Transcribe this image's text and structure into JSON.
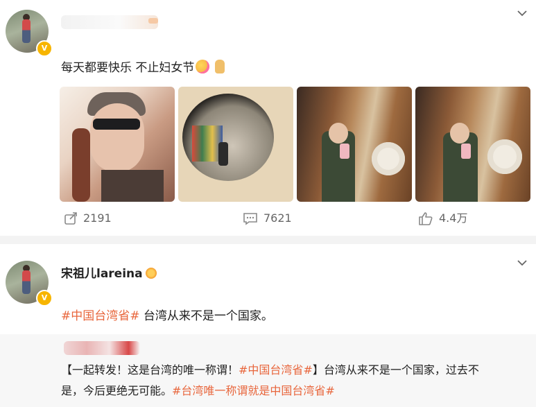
{
  "post1": {
    "text_before_emoji": "每天都要快乐 不止妇女节",
    "emoji1": "party-face-emoji",
    "emoji2": "thumbs-up-emoji",
    "actions": {
      "repost_count": "2191",
      "comment_count": "7621",
      "like_count": "4.4万"
    }
  },
  "post2": {
    "author_name": "宋祖儿lareina",
    "tag1": "#中国台湾省#",
    "body": " 台湾从来不是一个国家。",
    "repost": {
      "line1_a": "【一起转发！这是台湾的唯一称谓！",
      "line1_tag": "#中国台湾省#",
      "line1_b": "】台湾从来不是一个国家，过去不",
      "line2_a": "是，今后更绝无可能。",
      "line2_tag": "#台湾唯一称谓就是中国台湾省#"
    }
  },
  "icons": {
    "verified": "verified-v-icon",
    "chevron": "chevron-down-icon",
    "repost": "repost-icon",
    "comment": "comment-icon",
    "like": "like-icon"
  },
  "colors": {
    "accent": "#e8663c",
    "badge": "#f7b500",
    "separator": "#f3f3f3"
  }
}
